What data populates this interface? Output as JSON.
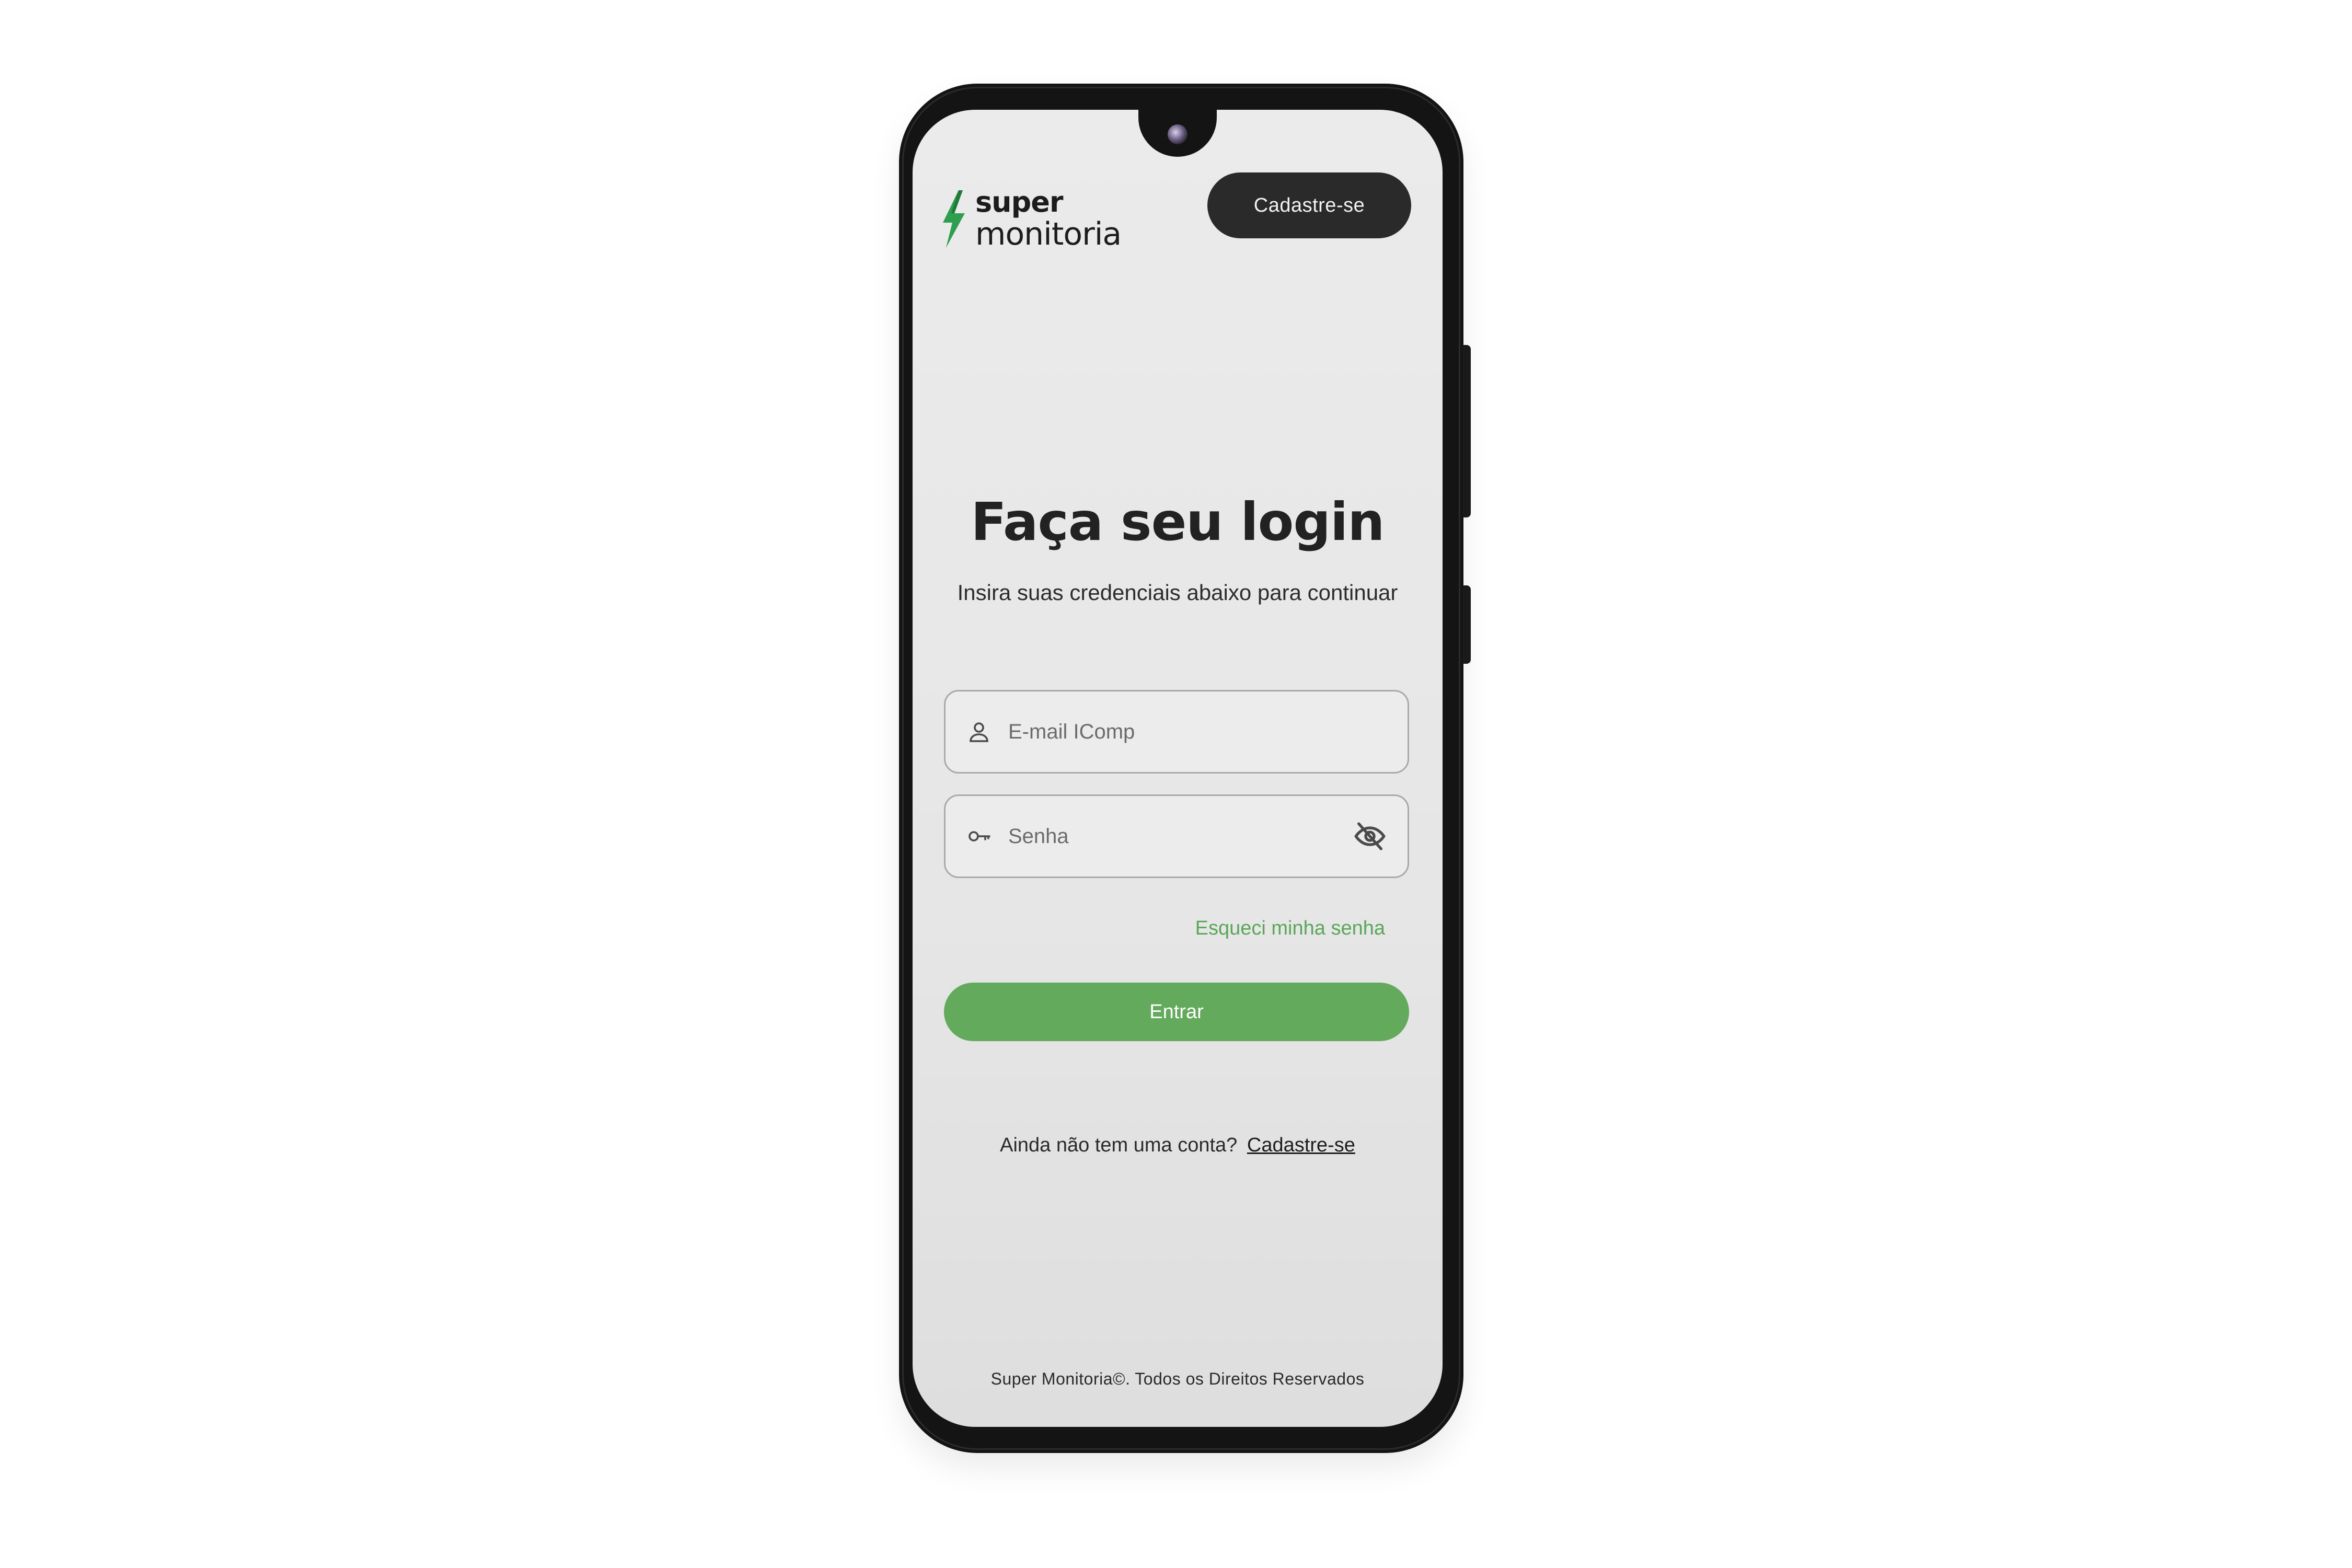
{
  "header": {
    "logo_top": "super",
    "logo_bottom": "monitoria",
    "signup_button": "Cadastre-se"
  },
  "login": {
    "title": "Faça seu login",
    "subtitle": "Insira suas credenciais abaixo para continuar",
    "email_placeholder": "E-mail IComp",
    "password_placeholder": "Senha",
    "forgot_password": "Esqueci minha senha",
    "submit": "Entrar",
    "no_account_text": "Ainda não tem uma conta?",
    "signup_link": "Cadastre-se"
  },
  "footer": {
    "copyright": "Super Monitoria©. Todos os Direitos Reservados"
  },
  "icons": {
    "logo": "lightning-bolt-icon",
    "email": "user-icon",
    "password": "key-icon",
    "toggle_visibility": "eye-off-icon"
  },
  "colors": {
    "accent_green": "#63aa5c",
    "link_green": "#5aa65a",
    "dark_button": "#2a2a2a",
    "logo_green": "#2e9e4f"
  }
}
